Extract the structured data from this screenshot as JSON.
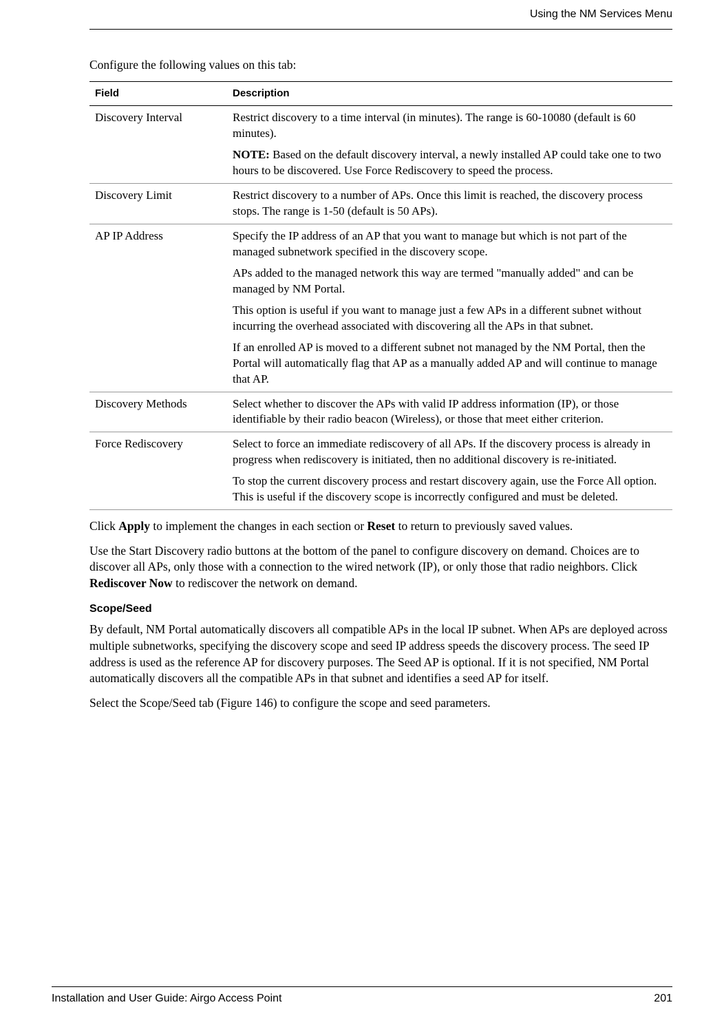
{
  "header": {
    "section_title": "Using the NM Services Menu"
  },
  "intro": "Configure the following values on this tab:",
  "table": {
    "col1_header": "Field",
    "col2_header": "Description",
    "rows": [
      {
        "field": "Discovery Interval",
        "paras": [
          {
            "prefix": "",
            "text": "Restrict discovery to a time interval (in minutes). The range is 60-10080 (default is 60 minutes)."
          },
          {
            "prefix": "NOTE: ",
            "text": "Based on the default discovery interval, a newly installed AP could take one to two hours to be discovered. Use Force Rediscovery to speed the process."
          }
        ]
      },
      {
        "field": "Discovery Limit",
        "paras": [
          {
            "prefix": "",
            "text": "Restrict discovery to a number of APs. Once this limit is reached, the discovery process stops. The range is 1-50 (default is 50 APs)."
          }
        ]
      },
      {
        "field": "AP IP Address",
        "paras": [
          {
            "prefix": "",
            "text": "Specify the IP address of an AP that you want to manage but which is not part of the managed subnetwork specified in the discovery scope."
          },
          {
            "prefix": "",
            "text": "APs added to the managed network this way are termed \"manually added\" and can be managed by NM Portal."
          },
          {
            "prefix": "",
            "text": "This option is useful if you want to manage just a few APs in a different subnet without incurring the overhead associated with discovering all the APs in that subnet."
          },
          {
            "prefix": "",
            "text": "If an enrolled AP is moved to a different subnet not managed by the NM Portal, then the Portal will automatically flag that AP as a manually added AP and will continue to manage that AP."
          }
        ]
      },
      {
        "field": "Discovery Methods",
        "paras": [
          {
            "prefix": "",
            "text": "Select whether to discover the APs with valid IP address information (IP), or those identifiable by their radio beacon (Wireless), or those that meet either criterion."
          }
        ]
      },
      {
        "field": "Force Rediscovery",
        "paras": [
          {
            "prefix": "",
            "text": "Select to force an immediate rediscovery of all APs. If the discovery process is already in progress when rediscovery is initiated, then no additional discovery is re-initiated."
          },
          {
            "prefix": "",
            "text": "To stop the current discovery process and restart discovery again, use the Force All option. This is useful if the discovery scope is incorrectly configured and must be deleted."
          }
        ]
      }
    ]
  },
  "para1": {
    "seg1": "Click ",
    "bold1": "Apply",
    "seg2": " to implement the changes in each section or ",
    "bold2": "Reset",
    "seg3": " to return to previously saved values."
  },
  "para2": {
    "seg1": "Use the Start Discovery radio buttons at the bottom of the panel to configure discovery on demand. Choices are to discover all APs, only those with a connection to the wired network (IP), or only those that radio neighbors. Click ",
    "bold1": "Rediscover Now",
    "seg2": " to rediscover the network on demand."
  },
  "section": {
    "heading": "Scope/Seed",
    "para1": "By default, NM Portal automatically discovers all compatible APs in the local IP subnet. When APs are deployed across multiple subnetworks, specifying the discovery scope and seed IP address speeds the discovery process. The seed IP address is used as the reference AP for discovery purposes. The Seed AP is optional. If it is not specified, NM Portal automatically discovers all the compatible APs in that subnet and identifies a seed AP for itself.",
    "para2": "Select the Scope/Seed tab (Figure 146) to configure the scope and seed parameters."
  },
  "footer": {
    "left": "Installation and User Guide: Airgo Access Point",
    "right": "201"
  }
}
